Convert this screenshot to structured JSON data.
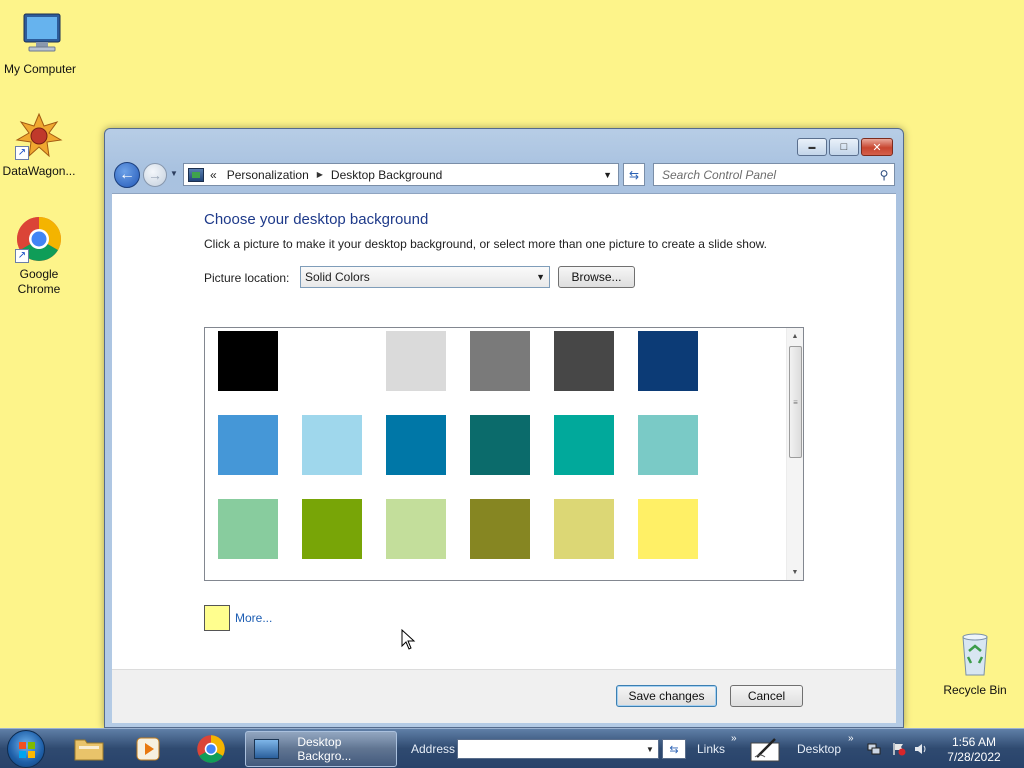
{
  "desktop": {
    "icons": [
      {
        "label": "My Computer"
      },
      {
        "label": "DataWagon..."
      },
      {
        "label": "Google Chrome"
      },
      {
        "label": "Recycle Bin"
      }
    ]
  },
  "window": {
    "breadcrumb": {
      "overflow": "«",
      "items": [
        "Personalization",
        "Desktop Background"
      ]
    },
    "search_placeholder": "Search Control Panel",
    "heading": "Choose your desktop background",
    "subtitle": "Click a picture to make it your desktop background, or select more than one picture to create a slide show.",
    "picture_location_label": "Picture location:",
    "picture_location_value": "Solid Colors",
    "browse_label": "Browse...",
    "swatches": [
      "#000000",
      "#ffffff",
      "#dadada",
      "#7a7a7a",
      "#474747",
      "#0c3b76",
      "#4597d7",
      "#9fd7ec",
      "#0077a7",
      "#0b6b6b",
      "#01a99b",
      "#7acac6",
      "#88cc9e",
      "#78a507",
      "#c3de9b",
      "#868622",
      "#dcd775",
      "#fff066"
    ],
    "selected_color": "#fffe8e",
    "more_label": "More...",
    "save_label": "Save changes",
    "cancel_label": "Cancel",
    "caption": {
      "minimize": "▬",
      "maximize": "□",
      "close": "✕"
    }
  },
  "taskbar": {
    "active_task": "Desktop Backgro...",
    "address_label": "Address",
    "address_value": "",
    "links_label": "Links",
    "desktop_label": "Desktop",
    "time": "1:56 AM",
    "date": "7/28/2022"
  }
}
